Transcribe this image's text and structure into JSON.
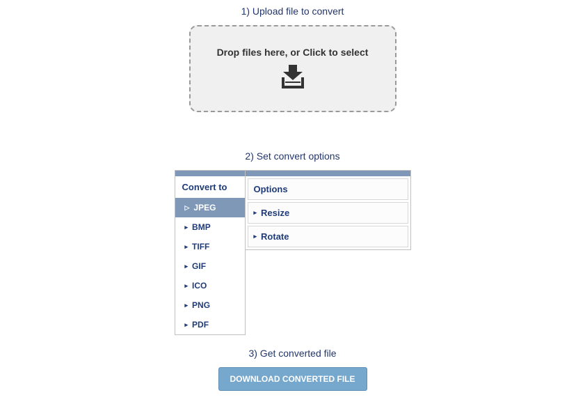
{
  "step1": {
    "heading": "1) Upload file to convert",
    "dropzone_text": "Drop files here, or Click to select"
  },
  "step2": {
    "heading": "2) Set convert options",
    "convert_title": "Convert to",
    "formats": [
      "JPEG",
      "BMP",
      "TIFF",
      "GIF",
      "ICO",
      "PNG",
      "PDF"
    ],
    "active_format_index": 0,
    "options_title": "Options",
    "options": [
      "Resize",
      "Rotate"
    ]
  },
  "step3": {
    "heading": "3) Get converted file",
    "button_label": "DOWNLOAD CONVERTED FILE"
  },
  "colors": {
    "accent_blue": "#7f98b7",
    "text_navy": "#1f3b78",
    "button_blue": "#76a7cc"
  }
}
